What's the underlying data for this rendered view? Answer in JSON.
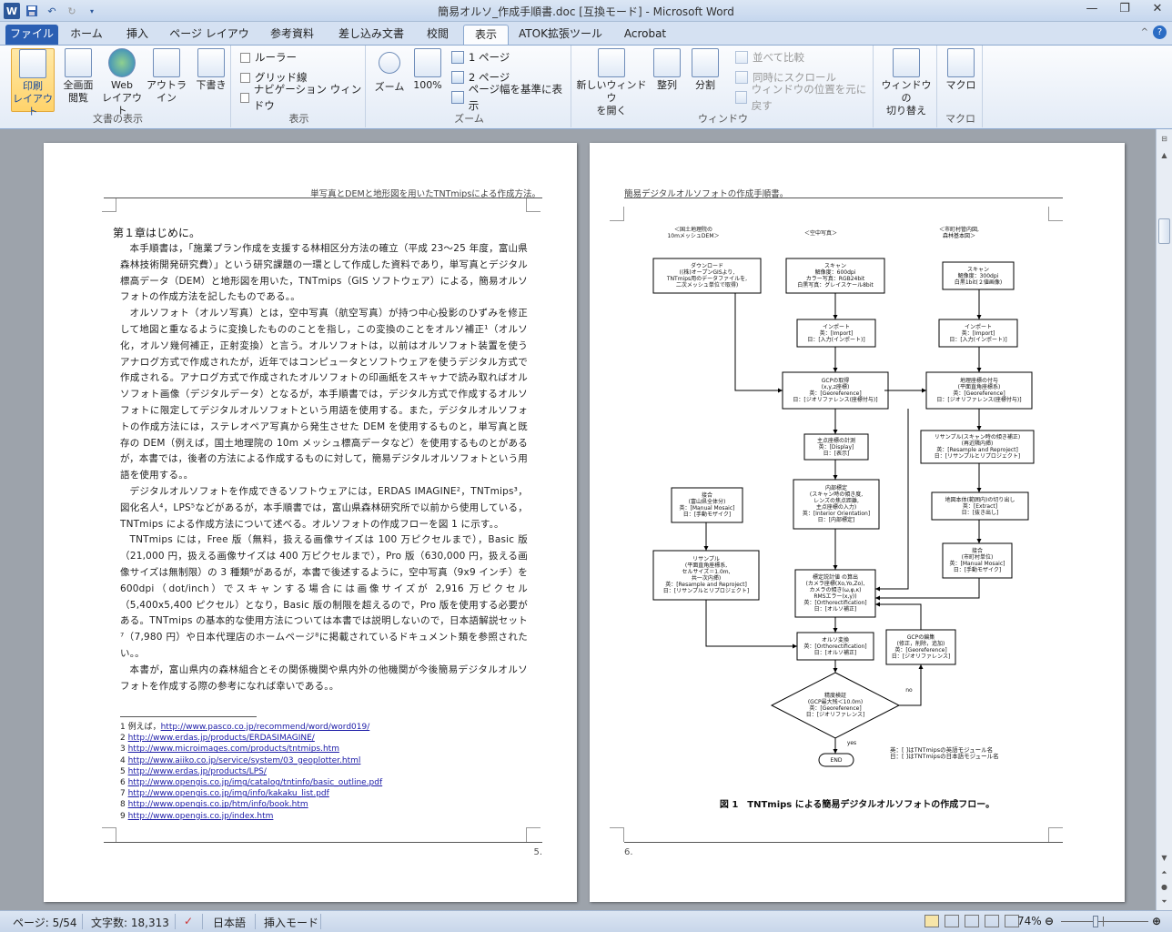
{
  "title": {
    "text": "簡易オルソ_作成手順書.doc [互換モード] - Microsoft Word",
    "word_icon": "W"
  },
  "tabs": [
    "ファイル",
    "ホーム",
    "挿入",
    "ページ レイアウト",
    "参考資料",
    "差し込み文書",
    "校閲",
    "表示",
    "ATOK拡張ツール",
    "Acrobat"
  ],
  "ribbon": {
    "doc_view": {
      "label": "文書の表示",
      "buttons": [
        "印刷\nレイアウト",
        "全画面\n閲覧",
        "Web\nレイアウト",
        "アウトライン",
        "下書き"
      ]
    },
    "show": {
      "label": "表示",
      "items": [
        "ルーラー",
        "グリッド線",
        "ナビゲーション ウィンドウ"
      ]
    },
    "zoom": {
      "label": "ズーム",
      "zoom": "ズーム",
      "percent": "100%",
      "one_page": "1 ページ",
      "two_pages": "2 ページ",
      "page_width": "ページ幅を基準に表示"
    },
    "window": {
      "label": "ウィンドウ",
      "new_window": "新しいウィンドウ\nを開く",
      "arrange": "整列",
      "split": "分割",
      "side_by_side": "並べて比較",
      "sync_scroll": "同時にスクロール",
      "reset_pos": "ウィンドウの位置を元に戻す",
      "switch": "ウィンドウの\n切り替え"
    },
    "macro": {
      "label": "マクロ",
      "macro": "マクロ"
    }
  },
  "page5": {
    "header": "単写真とDEMと地形図を用いたTNTmipsによる作成方法。",
    "chapter": "第１章はじめに。",
    "paragraphs": [
      "本手順書は，「施業プラン作成を支援する林相区分方法の確立（平成 23～25 年度，富山県森林技術開発研究費）」という研究課題の一環として作成した資料であり，単写真とデジタル標高データ（DEM）と地形図を用いた，TNTmips（GIS ソフトウェア）による，簡易オルソフォトの作成方法を記したものである。。",
      "オルソフォト（オルソ写真）とは，空中写真（航空写真）が持つ中心投影のひずみを修正して地図と重なるように変換したもののことを指し，この変換のことをオルソ補正¹（オルソ化，オルソ幾何補正，正射変換）と言う。オルソフォトは，以前はオルソフォト装置を使うアナログ方式で作成されたが，近年ではコンピュータとソフトウェアを使うデジタル方式で作成される。アナログ方式で作成されたオルソフォトの印画紙をスキャナで読み取ればオルソフォト画像（デジタルデータ）となるが，本手順書では，デジタル方式で作成するオルソフォトに限定してデジタルオルソフォトという用語を使用する。また，デジタルオルソフォトの作成方法には，ステレオペア写真から発生させた DEM を使用するものと，単写真と既存の DEM（例えば，国土地理院の 10m メッシュ標高データなど）を使用するものとがあるが，本書では，後者の方法による作成するものに対して，簡易デジタルオルソフォトという用語を使用する。。",
      "デジタルオルソフォトを作成できるソフトウェアには，ERDAS IMAGINE²，TNTmips³，図化名人⁴，LPS⁵などがあるが，本手順書では，富山県森林研究所で以前から使用している，TNTmips による作成方法について述べる。オルソフォトの作成フローを図 1 に示す。。",
      "TNTmips には，Free 版（無料，扱える画像サイズは 100 万ピクセルまで），Basic 版（21,000 円，扱える画像サイズは 400 万ピクセルまで），Pro 版（630,000 円，扱える画像サイズは無制限）の 3 種類⁶があるが，本書で後述するように，空中写真（9x9 インチ）を 600dpi（dot/inch）でスキャンする場合には画像サイズが 2,916 万ピクセル（5,400x5,400 ピクセル）となり，Basic 版の制限を超えるので，Pro 版を使用する必要がある。TNTmips の基本的な使用方法については本書では説明しないので，日本語解説セット⁷（7,980 円）や日本代理店のホームページ⁸に掲載されているドキュメント類を参照されたい。。",
      "本書が，富山県内の森林組合とその関係機関や県内外の他機関が今後簡易デジタルオルソフォトを作成する際の参考になれば幸いである。。"
    ],
    "footnotes": [
      {
        "n": "1",
        "pre": "例えば，",
        "url": "http://www.pasco.co.jp/recommend/word/word019/"
      },
      {
        "n": "2",
        "pre": "",
        "url": "http://www.erdas.jp/products/ERDASIMAGINE/"
      },
      {
        "n": "3",
        "pre": "",
        "url": "http://www.microimages.com/products/tntmips.htm"
      },
      {
        "n": "4",
        "pre": "",
        "url": "http://www.aiiko.co.jp/service/system/03_geoplotter.html"
      },
      {
        "n": "5",
        "pre": "",
        "url": "http://www.erdas.jp/products/LPS/"
      },
      {
        "n": "6",
        "pre": "",
        "url": "http://www.opengis.co.jp/img/catalog/tntinfo/basic_outline.pdf"
      },
      {
        "n": "7",
        "pre": "",
        "url": "http://www.opengis.co.jp/img/info/kakaku_list.pdf"
      },
      {
        "n": "8",
        "pre": "",
        "url": "http://www.opengis.co.jp/htm/info/book.htm"
      },
      {
        "n": "9",
        "pre": "",
        "url": "http://www.opengis.co.jp/index.htm"
      }
    ],
    "page_number": "5."
  },
  "page6": {
    "header": "簡易デジタルオルソフォトの作成手順書。",
    "col_heads": [
      "＜国土地理院の\n10mメッシュDEM＞",
      "＜空中写真＞",
      "＜市町村管内図,\n森林基本図＞"
    ],
    "boxes": {
      "download": "ダウンロード\n((株)オープンGISより,\nTNTmips用のデータファイルを,\n二次メッシュ単位で取得)",
      "scan1": "スキャン\n解像度：600dpi\nカラー写真：RGB24bit\n白黒写真：グレイスケール8bit",
      "scan2": "スキャン\n解像度：300dpi\n白黒1bit(２値画像)",
      "import1": "インポート\n英：[Import]\n日：[入力(インポート)]",
      "import2": "インポート\n英：[Import]\n日：[入力(インポート)]",
      "gcp": "GCPの取得\n(x,y,z座標)\n英：[Georeference]\n日：[ジオリファレンス(座標付与)]",
      "georef": "地理座標の付与\n(平面直角座標系)\n英：[Georeference]\n日：[ジオリファレンス(座標付与)]",
      "principal": "主点座標の計測\n英：[Display]\n日：[表示]",
      "resample1": "リサンプル(スキャン時の傾き補正)\n(再近隣内挿)\n英：[Resample and Reproject]\n日：[リサンプルとリプロジェクト]",
      "mosaic1": "接合\n(富山県全体分)\n英：[Manual Mosaic]\n日：[手動モザイク]",
      "interior": "内部標定\n(スキャン時の傾き度,\nレンズの焦点距離,\n主点座標の入力)\n英：[Interior Orientation]\n日：[内部標定]",
      "extract": "地図本体(範囲内)の切り出し\n英：[Extract]\n日：[抜き出し]",
      "resample2": "リサンプル\n(平面直角座標系,\nセルサイズ＝1.0m,\n共一次内挿)\n英：[Resample and Reproject]\n日：[リサンプルとリプロジェクト]",
      "mosaic2": "接合\n(市町村単位)\n英：[Manual Mosaic]\n日：[手動モザイク]",
      "exterior": "標定説計値 の算出\n(カメラ座標(Xo,Yo,Zo),\nカメラの傾き(ω,φ,κ)\nRMSエラー(x,y))\n英：[Orthorectification]\n日：[オルソ補正]",
      "ortho": "オルソ変換\n英：[Orthorectification]\n日：[オルソ補正]",
      "gcpedit": "GCPの編集\n(修正，削除，追加)\n英：[Georeference]\n日：[ジオリファレンス]",
      "check": "精度検証\n(GCP最大残＜10.0m)\n英：[Georeference]\n日：[ジオリファレンス]",
      "end": "END",
      "no": "no",
      "yes": "yes"
    },
    "legend": "英：[ ]はTNTmipsの英語モジュール名\n日：[ ]はTNTmipsの日本語モジュール名",
    "caption": "図 1　TNTmips による簡易デジタルオルソフォトの作成フロー。",
    "page_number": "6."
  },
  "status": {
    "page": "ページ: 5/54",
    "words": "文字数: 18,313",
    "lang": "日本語",
    "mode": "挿入モード",
    "zoom": "74%"
  }
}
